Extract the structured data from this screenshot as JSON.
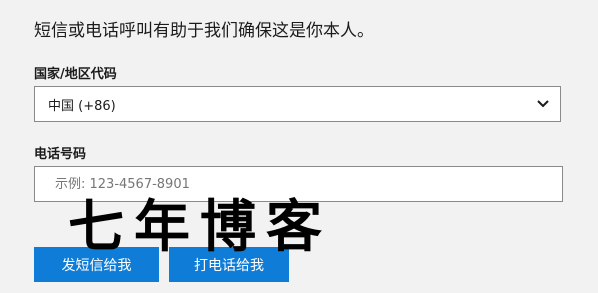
{
  "intro": {
    "text": "短信或电话呼叫有助于我们确保这是你本人。"
  },
  "country": {
    "label": "国家/地区代码",
    "selected": "中国 (+86)"
  },
  "phone": {
    "label": "电话号码",
    "value": "",
    "placeholder": "示例: 123-4567-8901"
  },
  "buttons": {
    "sms_label": "发短信给我",
    "call_label": "打电话给我"
  },
  "watermark": {
    "text": "七年博客"
  },
  "colors": {
    "accent": "#0f7dd8",
    "background": "#f2f2f2",
    "watermark": "#000000"
  }
}
